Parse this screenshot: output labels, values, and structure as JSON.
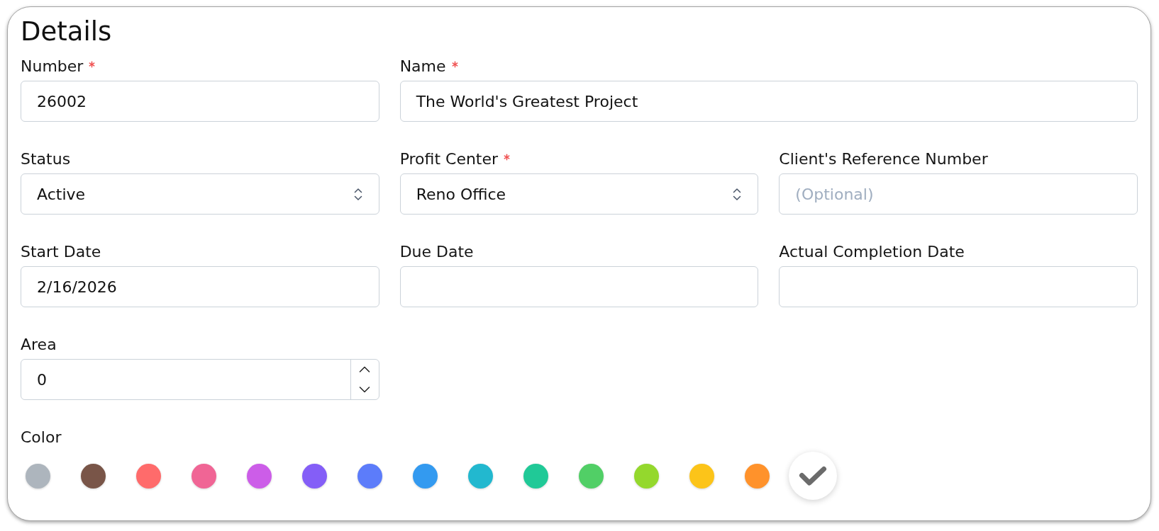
{
  "card": {
    "title": "Details"
  },
  "rows": [
    [
      {
        "kind": "text",
        "label": "Number",
        "required": true,
        "value": "26002"
      },
      {
        "kind": "text",
        "label": "Name",
        "required": true,
        "value": "The World's Greatest Project"
      }
    ],
    [
      {
        "kind": "select",
        "label": "Status",
        "required": false,
        "value": "Active"
      },
      {
        "kind": "select",
        "label": "Profit Center",
        "required": true,
        "value": "Reno Office"
      },
      {
        "kind": "text",
        "label": "Client's Reference Number",
        "required": false,
        "placeholder": "(Optional)"
      }
    ],
    [
      {
        "kind": "text",
        "label": "Start Date",
        "required": false,
        "value": "2/16/2026"
      },
      {
        "kind": "text",
        "label": "Due Date",
        "required": false
      },
      {
        "kind": "text",
        "label": "Actual Completion Date",
        "required": false
      }
    ],
    [
      {
        "kind": "number",
        "label": "Area",
        "required": false,
        "value": "0"
      }
    ]
  ],
  "color_picker": {
    "label": "Color",
    "options": [
      {
        "color": "#adb5bd",
        "selected": false
      },
      {
        "color": "#795548",
        "selected": false
      },
      {
        "color": "#ff6b6b",
        "selected": false
      },
      {
        "color": "#f06595",
        "selected": false
      },
      {
        "color": "#cc5de8",
        "selected": false
      },
      {
        "color": "#845ef7",
        "selected": false
      },
      {
        "color": "#5c7cfa",
        "selected": false
      },
      {
        "color": "#339af0",
        "selected": false
      },
      {
        "color": "#22b8cf",
        "selected": false
      },
      {
        "color": "#20c997",
        "selected": false
      },
      {
        "color": "#51cf66",
        "selected": false
      },
      {
        "color": "#94d82d",
        "selected": false
      },
      {
        "color": "#fcc419",
        "selected": false
      },
      {
        "color": "#ff922b",
        "selected": false
      },
      {
        "color": "#ffffff",
        "selected": true
      }
    ]
  }
}
